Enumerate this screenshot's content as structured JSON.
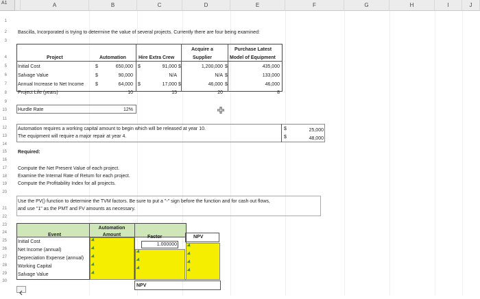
{
  "name_box": "A1",
  "columns": [
    "A",
    "B",
    "C",
    "D",
    "E",
    "F",
    "G",
    "H",
    "I",
    "J"
  ],
  "rows": [
    "1",
    "2",
    "3",
    "4",
    "5",
    "6",
    "7",
    "8",
    "9",
    "10",
    "11",
    "12",
    "13",
    "14",
    "15",
    "16",
    "17",
    "18",
    "19",
    "20",
    "21",
    "22",
    "23",
    "24",
    "25",
    "26",
    "27",
    "28",
    "29",
    "30"
  ],
  "intro": "Bascilla, Incorporated is trying to determine the value of several projects. Currently there are four being examined:",
  "table": {
    "project_header": "Project",
    "automation": "Automation",
    "hire_extra_crew": "Hire Extra Crew",
    "acquire_a": "Acquire a",
    "supplier": "Supplier",
    "purchase_latest": "Purchase Latest",
    "model_of_equipment": "Model of Equipment",
    "rows": [
      {
        "label": "Initial Cost",
        "a_sym": "$",
        "a": "650,000",
        "b_sym": "$",
        "b": "91,000",
        "c_sym": "$",
        "c": "1,200,000",
        "d_sym": "$",
        "d": "435,000"
      },
      {
        "label": "Salvage Value",
        "a_sym": "$",
        "a": "90,000",
        "b_sym": "",
        "b": "N/A",
        "c_sym": "",
        "c": "N/A",
        "d_sym": "$",
        "d": "133,000"
      },
      {
        "label": "Annual Increase to Net Income",
        "a_sym": "$",
        "a": "64,000",
        "b_sym": "$",
        "b": "17,000",
        "c_sym": "$",
        "c": "46,000",
        "d_sym": "$",
        "d": "46,000"
      },
      {
        "label": "Project Life (years)",
        "a_sym": "",
        "a": "10",
        "b_sym": "",
        "b": "15",
        "c_sym": "",
        "c": "20",
        "d_sym": "",
        "d": "8"
      }
    ]
  },
  "hurdle_label": "Hurdle Rate",
  "hurdle_value": "12%",
  "automation_note": "Automation requires a working capital amount to begin which will be released at year 10.",
  "equipment_note": "The equipment will require a major repair at year 4.",
  "note_values": [
    {
      "sym": "$",
      "value": "25,000"
    },
    {
      "sym": "$",
      "value": "48,000"
    }
  ],
  "required": "Required:",
  "tasks": [
    "Compute the Net Present Value of each project.",
    "Examine the Internal Rate of Return for each project.",
    "Compute the Profitability Index for all projects."
  ],
  "pv_instruction_1": "Use the PV() function to determine the TVM factors. Be sure to put a \"-\" sign before the function and for cash out flows,",
  "pv_instruction_2": "and use \"1\" as the PMT and FV amounts as necessary.",
  "npv_table": {
    "automation": "Automation",
    "amount": "Amount",
    "event": "Event",
    "factor": "Factor",
    "npv": "NPV",
    "factor_value": "1.000000",
    "events": [
      "Initial Cost",
      "Net Income (annual)",
      "Depreciation Expense (annual)",
      "Working Capital",
      "Salvage Value"
    ],
    "npv_total_label": "NPV"
  },
  "colors": {
    "yellow": "#f5ee00",
    "green": "#cfe6b8",
    "grid": "#efefef"
  }
}
